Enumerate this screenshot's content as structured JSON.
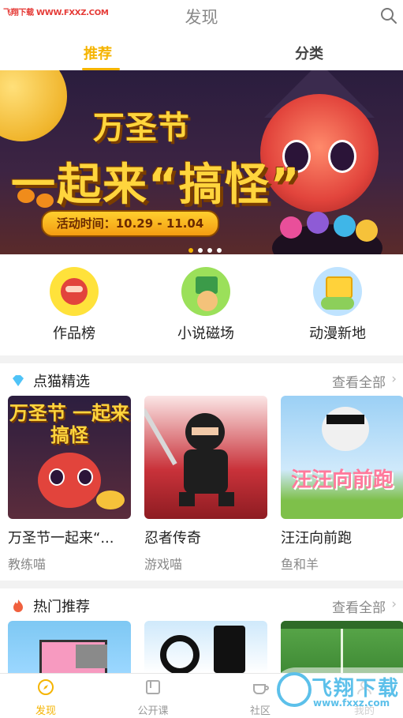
{
  "watermark": {
    "text": "飞翔下载 WWW.FXXZ.COM"
  },
  "header": {
    "title": "发现",
    "search_icon": "search-icon"
  },
  "tabs": [
    {
      "label": "推荐",
      "active": true
    },
    {
      "label": "分类",
      "active": false
    }
  ],
  "banner": {
    "title_line1": "万圣节",
    "title_line2": "一起来“搞怪”",
    "date_text": "活动时间：10.29 - 11.04",
    "dots": 4,
    "active_dot": 0
  },
  "quick_entries": [
    {
      "label": "作品榜",
      "icon": "ranking-icon"
    },
    {
      "label": "小说磁场",
      "icon": "novel-icon"
    },
    {
      "label": "动漫新地",
      "icon": "anime-icon"
    }
  ],
  "featured": {
    "title": "点猫精选",
    "icon": "diamond-icon",
    "more": "查看全部",
    "cards": [
      {
        "title": "万圣节一起来“...",
        "author": "教练喵",
        "art_text": "万圣节 一起来搞怪"
      },
      {
        "title": "忍者传奇",
        "author": "游戏喵"
      },
      {
        "title": "汪汪向前跑",
        "author": "鱼和羊",
        "art_text": "汪汪向前跑"
      }
    ]
  },
  "hot": {
    "title": "热门推荐",
    "icon": "flame-icon",
    "more": "查看全部"
  },
  "bottom_nav": [
    {
      "label": "发现",
      "icon": "discover-icon",
      "active": true
    },
    {
      "label": "公开课",
      "icon": "book-icon",
      "active": false
    },
    {
      "label": "社区",
      "icon": "cup-icon",
      "active": false
    },
    {
      "label": "我的",
      "icon": "user-icon",
      "active": false
    }
  ],
  "site_watermark": {
    "name": "飞翔下载",
    "url": "www.fxxz.com"
  },
  "colors": {
    "accent": "#f5b400",
    "text": "#222222",
    "muted": "#888888"
  }
}
